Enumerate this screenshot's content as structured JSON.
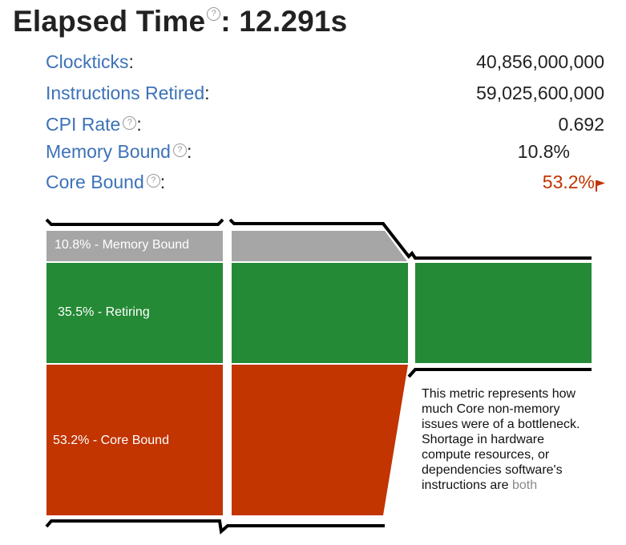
{
  "header": {
    "title": "Elapsed Time",
    "help_glyph": "?",
    "separator": ":",
    "value": "12.291s"
  },
  "metrics": [
    {
      "label": "Clockticks",
      "value": "40,856,000,000",
      "has_help": false
    },
    {
      "label": "Instructions Retired",
      "value": "59,025,600,000",
      "has_help": false
    },
    {
      "label": "CPI Rate",
      "value": "0.692",
      "has_help": true
    },
    {
      "label": "Memory Bound",
      "value": "10.8%",
      "has_help": true
    },
    {
      "label": "Core Bound",
      "value": "53.2%",
      "has_help": true,
      "flagged": true
    }
  ],
  "colors": {
    "memory": "#a6a6a6",
    "retiring": "#248a35",
    "core": "#c23400",
    "link": "#3c72b8",
    "flag": "#c23400"
  },
  "flow": {
    "memory_label": "10.8% - Memory Bound",
    "retiring_label": "35.5% - Retiring",
    "core_label": "53.2% - Core Bound",
    "tooltip_text": "This metric represents how much Core non-memory issues were of a bottleneck. Shortage in hardware compute resources, or dependencies software's instructions are",
    "tooltip_fade": "both"
  }
}
